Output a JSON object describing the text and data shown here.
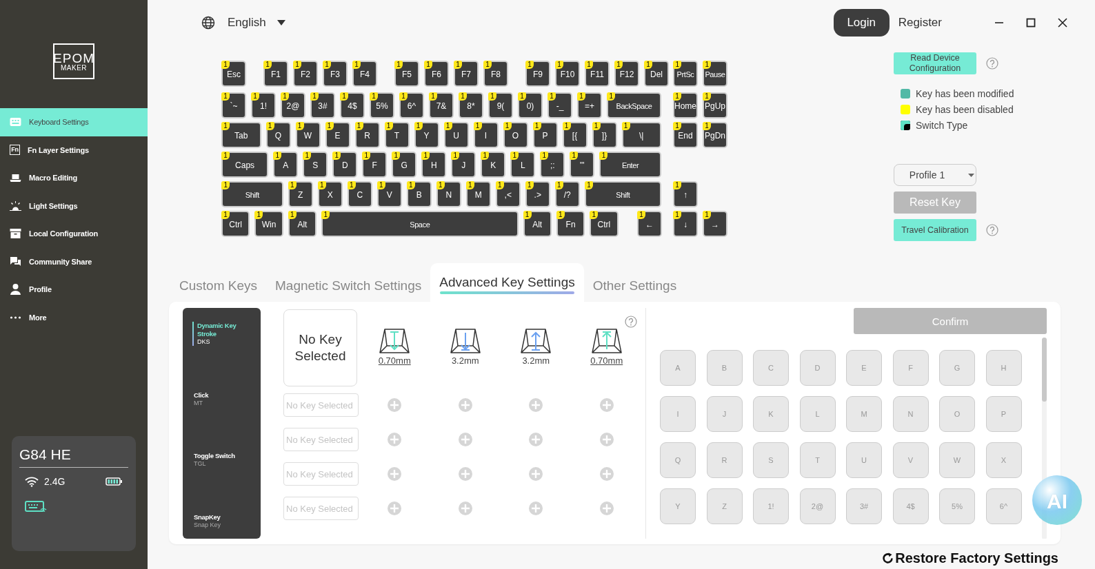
{
  "sidebar": {
    "logo": {
      "top": "EPOM",
      "bottom": "MAKER"
    },
    "items": [
      {
        "label": "Keyboard Settings",
        "selected": true
      },
      {
        "label": "Fn Layer Settings",
        "icon_text": "Fn",
        "selected": false
      },
      {
        "label": "Macro Editing",
        "selected": false
      },
      {
        "label": "Light Settings",
        "selected": false
      },
      {
        "label": "Local Configuration",
        "selected": false
      },
      {
        "label": "Community Share",
        "selected": false
      },
      {
        "label": "Profile",
        "selected": false
      },
      {
        "label": "More",
        "selected": false
      }
    ],
    "device": {
      "name": "G84 HE",
      "connection": "2.4G"
    }
  },
  "topbar": {
    "language": "English",
    "login": "Login",
    "register": "Register"
  },
  "keyboard": {
    "rows": [
      {
        "keys": [
          {
            "label": "Esc",
            "layer": "1"
          },
          {
            "label": "F1",
            "layer": "1"
          },
          {
            "label": "F2",
            "layer": "1"
          },
          {
            "label": "F3",
            "layer": "1"
          },
          {
            "label": "F4",
            "layer": "1"
          },
          {
            "label": "F5",
            "layer": "1"
          },
          {
            "label": "F6",
            "layer": "1"
          },
          {
            "label": "F7",
            "layer": "1"
          },
          {
            "label": "F8",
            "layer": "1"
          },
          {
            "label": "F9",
            "layer": "1"
          },
          {
            "label": "F10",
            "layer": "1"
          },
          {
            "label": "F11",
            "layer": "1"
          },
          {
            "label": "F12",
            "layer": "1"
          },
          {
            "label": "Del",
            "layer": "1"
          }
        ],
        "nav_keys": [
          {
            "label": "PrtSc",
            "layer": "1"
          },
          {
            "label": "Pause",
            "layer": "1"
          }
        ]
      },
      {
        "keys": [
          {
            "label": "`~",
            "layer": "1"
          },
          {
            "label": "1!",
            "layer": "1"
          },
          {
            "label": "2@",
            "layer": "1"
          },
          {
            "label": "3#",
            "layer": "1"
          },
          {
            "label": "4$",
            "layer": "1"
          },
          {
            "label": "5%",
            "layer": "1"
          },
          {
            "label": "6^",
            "layer": "1"
          },
          {
            "label": "7&",
            "layer": "1"
          },
          {
            "label": "8*",
            "layer": "1"
          },
          {
            "label": "9(",
            "layer": "1"
          },
          {
            "label": "0)",
            "layer": "1"
          },
          {
            "label": "-_",
            "layer": "1"
          },
          {
            "label": "=+",
            "layer": "1"
          },
          {
            "label": "BackSpace",
            "layer": "1"
          }
        ],
        "nav_keys": [
          {
            "label": "Home",
            "layer": "1"
          },
          {
            "label": "PgUp",
            "layer": "1"
          }
        ]
      },
      {
        "keys": [
          {
            "label": "Tab",
            "layer": "1"
          },
          {
            "label": "Q",
            "layer": "1"
          },
          {
            "label": "W",
            "layer": "1"
          },
          {
            "label": "E",
            "layer": "1"
          },
          {
            "label": "R",
            "layer": "1"
          },
          {
            "label": "T",
            "layer": "1"
          },
          {
            "label": "Y",
            "layer": "1"
          },
          {
            "label": "U",
            "layer": "1"
          },
          {
            "label": "I",
            "layer": "1"
          },
          {
            "label": "O",
            "layer": "1"
          },
          {
            "label": "P",
            "layer": "1"
          },
          {
            "label": "[{",
            "layer": "1"
          },
          {
            "label": "]}",
            "layer": "1"
          },
          {
            "label": "\\|",
            "layer": "1"
          }
        ],
        "nav_keys": [
          {
            "label": "End",
            "layer": "1"
          },
          {
            "label": "PgDn",
            "layer": "1"
          }
        ]
      },
      {
        "keys": [
          {
            "label": "Caps",
            "layer": "1"
          },
          {
            "label": "A",
            "layer": "1"
          },
          {
            "label": "S",
            "layer": "1"
          },
          {
            "label": "D",
            "layer": "1"
          },
          {
            "label": "F",
            "layer": "1"
          },
          {
            "label": "G",
            "layer": "1"
          },
          {
            "label": "H",
            "layer": "1"
          },
          {
            "label": "J",
            "layer": "1"
          },
          {
            "label": "K",
            "layer": "1"
          },
          {
            "label": "L",
            "layer": "1"
          },
          {
            "label": ";:",
            "layer": "1"
          },
          {
            "label": "'\"",
            "layer": "1"
          },
          {
            "label": "Enter",
            "layer": "1"
          }
        ]
      },
      {
        "keys": [
          {
            "label": "Shift",
            "layer": "1"
          },
          {
            "label": "Z",
            "layer": "1"
          },
          {
            "label": "X",
            "layer": "1"
          },
          {
            "label": "C",
            "layer": "1"
          },
          {
            "label": "V",
            "layer": "1"
          },
          {
            "label": "B",
            "layer": "1"
          },
          {
            "label": "N",
            "layer": "1"
          },
          {
            "label": "M",
            "layer": "1"
          },
          {
            "label": ",<",
            "layer": "1"
          },
          {
            "label": ".>",
            "layer": "1"
          },
          {
            "label": "/?",
            "layer": "1"
          },
          {
            "label": "Shift",
            "layer": "1"
          }
        ],
        "nav_keys": [
          {
            "label": "↑",
            "layer": "1"
          }
        ]
      },
      {
        "keys": [
          {
            "label": "Ctrl",
            "layer": "1"
          },
          {
            "label": "Win",
            "layer": "1"
          },
          {
            "label": "Alt",
            "layer": "1"
          },
          {
            "label": "Space",
            "layer": "1"
          },
          {
            "label": "Alt",
            "layer": "1"
          },
          {
            "label": "Fn",
            "layer": "1"
          },
          {
            "label": "Ctrl",
            "layer": "1"
          },
          {
            "label": "←",
            "layer": "1"
          }
        ],
        "nav_keys": [
          {
            "label": "↓",
            "layer": "1"
          },
          {
            "label": "→",
            "layer": "1"
          }
        ]
      }
    ]
  },
  "side_panel": {
    "read_button": "Read Device Configuration",
    "legend": [
      {
        "label": "Key has been modified",
        "kind": "solid",
        "color": "#52b9a6"
      },
      {
        "label": "Key has been disabled",
        "kind": "solid",
        "color": "#ffff00"
      },
      {
        "label": "Switch Type",
        "kind": "split",
        "color": "#000000"
      }
    ],
    "profile": "Profile 1",
    "reset_button": {
      "label": "Reset Key",
      "disabled": true
    },
    "calibration_button": "Travel Calibration"
  },
  "tabs": [
    {
      "label": "Custom Keys",
      "selected": false
    },
    {
      "label": "Magnetic Switch Settings",
      "selected": false
    },
    {
      "label": "Advanced Key Settings",
      "selected": true
    },
    {
      "label": "Other Settings",
      "selected": false
    }
  ],
  "advanced": {
    "modes": [
      {
        "name": "Dynamic Key Stroke",
        "code": "DKS",
        "selected": true
      },
      {
        "name": "Click",
        "code": "MT",
        "selected": false
      },
      {
        "name": "Toggle Switch",
        "code": "TGL",
        "selected": false
      },
      {
        "name": "SnapKey",
        "code": "Snap Key",
        "selected": false
      }
    ],
    "selected_key": "No Key Selected",
    "travel_points": [
      {
        "value": "0.70mm",
        "kind": "actuation",
        "underlined": true
      },
      {
        "value": "3.2mm",
        "kind": "bottom",
        "underlined": false
      },
      {
        "value": "3.2mm",
        "kind": "lift",
        "underlined": false
      },
      {
        "value": "0.70mm",
        "kind": "release",
        "underlined": true
      }
    ],
    "bindings": [
      {
        "placeholder": "No Key Selected"
      },
      {
        "placeholder": "No Key Selected"
      },
      {
        "placeholder": "No Key Selected"
      },
      {
        "placeholder": "No Key Selected"
      }
    ]
  },
  "key_picker": {
    "confirm": {
      "label": "Confirm",
      "disabled": true
    },
    "keys": [
      "A",
      "B",
      "C",
      "D",
      "E",
      "F",
      "G",
      "H",
      "I",
      "J",
      "K",
      "L",
      "M",
      "N",
      "O",
      "P",
      "Q",
      "R",
      "S",
      "T",
      "U",
      "V",
      "W",
      "X",
      "Y",
      "Z",
      "1!",
      "2@",
      "3#",
      "4$",
      "5%",
      "6^"
    ]
  },
  "restore": "Restore Factory Settings",
  "assistant": "AI"
}
